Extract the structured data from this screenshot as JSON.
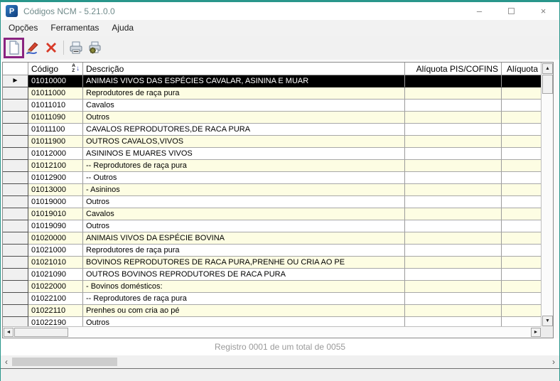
{
  "window": {
    "title": "Códigos NCM - 5.21.0.0",
    "app_initial": "P",
    "controls": {
      "minimize": "–",
      "close": "×"
    }
  },
  "menu": {
    "items": [
      {
        "label": "Opções"
      },
      {
        "label": "Ferramentas"
      },
      {
        "label": "Ajuda"
      }
    ]
  },
  "toolbar": {
    "buttons": [
      {
        "name": "new-record"
      },
      {
        "name": "edit-record"
      },
      {
        "name": "delete-record"
      },
      {
        "name": "print"
      },
      {
        "name": "print-settings"
      }
    ],
    "highlight_color": "#8A2380"
  },
  "grid": {
    "columns": [
      {
        "label": ""
      },
      {
        "label": "Código"
      },
      {
        "label": "Descrição"
      },
      {
        "label": "Alíquota PIS/COFINS"
      },
      {
        "label": "Alíquota"
      }
    ],
    "sort_icon": {
      "top": "A",
      "bottom": "Z",
      "arrow": "↓"
    },
    "selected_index": 0,
    "rows": [
      {
        "code": "01010000",
        "desc": "ANIMAIS VIVOS DAS ESPÉCIES CAVALAR, ASININA E MUAR",
        "pis": "",
        "aliquota": ""
      },
      {
        "code": "01011000",
        "desc": "Reprodutores de raça pura",
        "pis": "",
        "aliquota": ""
      },
      {
        "code": "01011010",
        "desc": "Cavalos",
        "pis": "",
        "aliquota": ""
      },
      {
        "code": "01011090",
        "desc": "Outros",
        "pis": "",
        "aliquota": ""
      },
      {
        "code": "01011100",
        "desc": "CAVALOS REPRODUTORES,DE RACA PURA",
        "pis": "",
        "aliquota": ""
      },
      {
        "code": "01011900",
        "desc": "OUTROS CAVALOS,VIVOS",
        "pis": "",
        "aliquota": ""
      },
      {
        "code": "01012000",
        "desc": "ASININOS E MUARES VIVOS",
        "pis": "",
        "aliquota": ""
      },
      {
        "code": "01012100",
        "desc": "-- Reprodutores de raça pura",
        "pis": "",
        "aliquota": ""
      },
      {
        "code": "01012900",
        "desc": "-- Outros",
        "pis": "",
        "aliquota": ""
      },
      {
        "code": "01013000",
        "desc": "- Asininos",
        "pis": "",
        "aliquota": ""
      },
      {
        "code": "01019000",
        "desc": "Outros",
        "pis": "",
        "aliquota": ""
      },
      {
        "code": "01019010",
        "desc": "Cavalos",
        "pis": "",
        "aliquota": ""
      },
      {
        "code": "01019090",
        "desc": "Outros",
        "pis": "",
        "aliquota": ""
      },
      {
        "code": "01020000",
        "desc": "ANIMAIS VIVOS DA ESPÉCIE BOVINA",
        "pis": "",
        "aliquota": ""
      },
      {
        "code": "01021000",
        "desc": "Reprodutores de raça pura",
        "pis": "",
        "aliquota": ""
      },
      {
        "code": "01021010",
        "desc": "BOVINOS REPRODUTORES DE RACA PURA,PRENHE OU CRIA AO PE",
        "pis": "",
        "aliquota": ""
      },
      {
        "code": "01021090",
        "desc": "OUTROS BOVINOS REPRODUTORES DE RACA PURA",
        "pis": "",
        "aliquota": ""
      },
      {
        "code": "01022000",
        "desc": "- Bovinos domésticos:",
        "pis": "",
        "aliquota": ""
      },
      {
        "code": "01022100",
        "desc": "-- Reprodutores de raça pura",
        "pis": "",
        "aliquota": ""
      },
      {
        "code": "01022110",
        "desc": "Prenhes ou com cria ao pé",
        "pis": "",
        "aliquota": ""
      },
      {
        "code": "01022190",
        "desc": "Outros",
        "pis": "",
        "aliquota": ""
      }
    ]
  },
  "status": {
    "text": "Registro 0001 de um total de 0055"
  },
  "colors": {
    "accent_teal": "#29968B",
    "highlight_purple": "#8A2380",
    "row_stripe": "#FDFDE3",
    "selected_row_bg": "#000000"
  }
}
